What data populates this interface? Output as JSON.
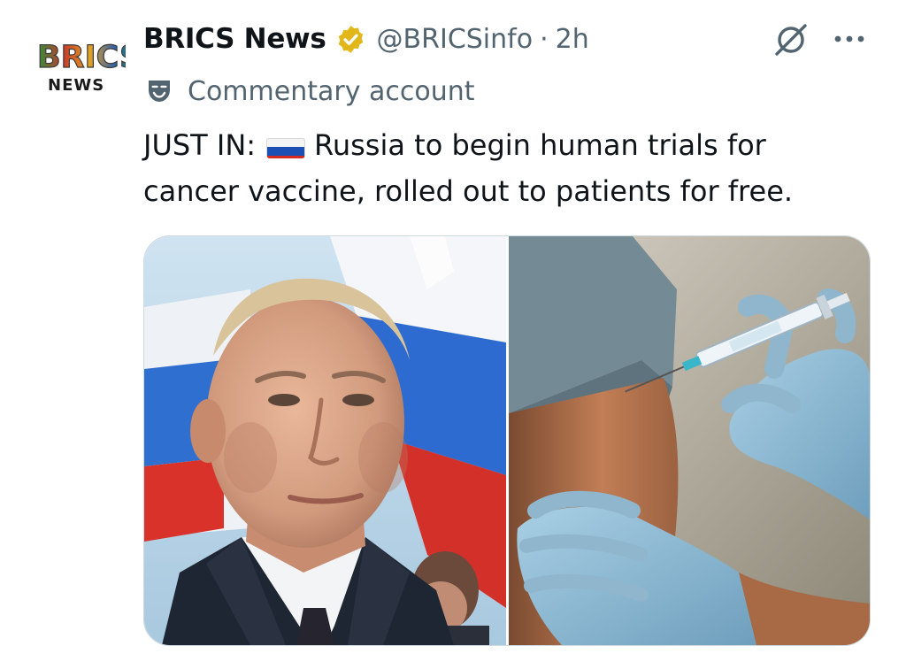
{
  "author": {
    "display_name": "BRICS News",
    "handle": "@BRICSinfo",
    "separator": "·",
    "time": "2h",
    "avatar_logo_text": "BRICS",
    "avatar_logo_subtext": "NEWS",
    "verified_badge": "gold-verified-badge-icon"
  },
  "label": {
    "icon": "theater-mask-icon",
    "text": "Commentary account"
  },
  "actions": {
    "grok_icon": "slashed-circle-icon",
    "more_icon": "ellipsis-icon"
  },
  "tweet": {
    "line1_prefix": "JUST IN:",
    "flag": "russia-flag-emoji",
    "line1_suffix": "Russia to begin human trials for",
    "line2": "cancer vaccine, rolled out to patients for free."
  },
  "media": {
    "left_image": "man-in-suit-with-russian-flags-photo",
    "right_image": "gloved-hands-giving-injection-in-arm-photo"
  },
  "colors": {
    "text_primary": "#0f1419",
    "text_secondary": "#536471",
    "verified_gold": "#e2b719",
    "border": "#cfd9de"
  }
}
